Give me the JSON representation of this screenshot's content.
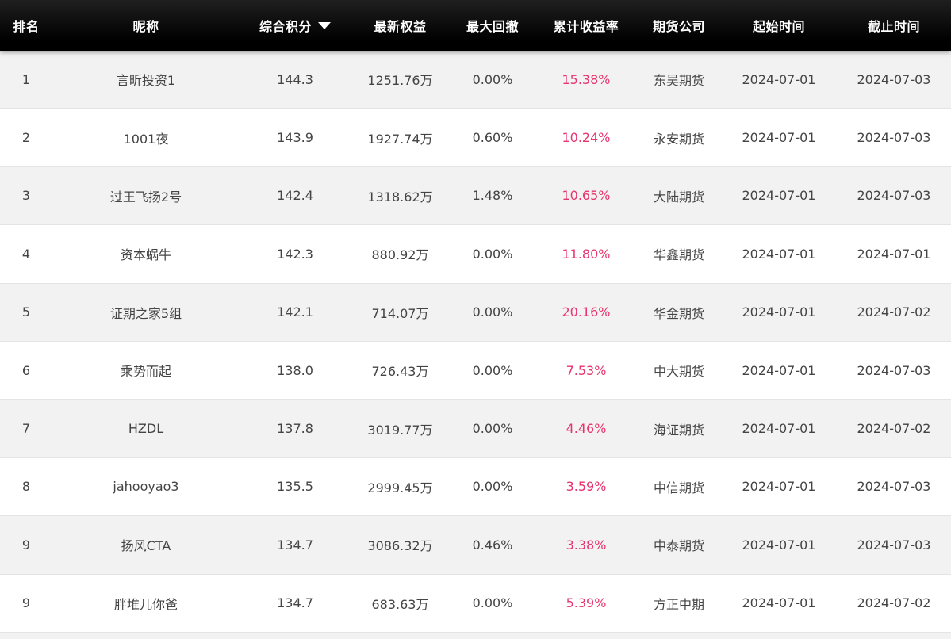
{
  "header": {
    "rank": "排名",
    "nickname": "昵称",
    "score": "综合积分",
    "equity": "最新权益",
    "max_drawdown": "最大回撤",
    "cum_return": "累计收益率",
    "broker": "期货公司",
    "start_date": "起始时间",
    "end_date": "截止时间"
  },
  "sort": {
    "column": "综合积分",
    "direction": "descending",
    "icon": "sort-down-triangle-icon"
  },
  "colors": {
    "header_bg": "#000000",
    "return_text": "#e8336d",
    "stripe_bg": "#f2f2f2"
  },
  "rows": [
    {
      "rank": "1",
      "nickname": "言昕投资1",
      "score": "144.3",
      "equity": "1251.76万",
      "max_drawdown": "0.00%",
      "cum_return": "15.38%",
      "broker": "东吴期货",
      "start_date": "2024-07-01",
      "end_date": "2024-07-03"
    },
    {
      "rank": "2",
      "nickname": "1001夜",
      "score": "143.9",
      "equity": "1927.74万",
      "max_drawdown": "0.60%",
      "cum_return": "10.24%",
      "broker": "永安期货",
      "start_date": "2024-07-01",
      "end_date": "2024-07-03"
    },
    {
      "rank": "3",
      "nickname": "过王飞扬2号",
      "score": "142.4",
      "equity": "1318.62万",
      "max_drawdown": "1.48%",
      "cum_return": "10.65%",
      "broker": "大陆期货",
      "start_date": "2024-07-01",
      "end_date": "2024-07-03"
    },
    {
      "rank": "4",
      "nickname": "资本蜗牛",
      "score": "142.3",
      "equity": "880.92万",
      "max_drawdown": "0.00%",
      "cum_return": "11.80%",
      "broker": "华鑫期货",
      "start_date": "2024-07-01",
      "end_date": "2024-07-01"
    },
    {
      "rank": "5",
      "nickname": "证期之家5组",
      "score": "142.1",
      "equity": "714.07万",
      "max_drawdown": "0.00%",
      "cum_return": "20.16%",
      "broker": "华金期货",
      "start_date": "2024-07-01",
      "end_date": "2024-07-02"
    },
    {
      "rank": "6",
      "nickname": "乘势而起",
      "score": "138.0",
      "equity": "726.43万",
      "max_drawdown": "0.00%",
      "cum_return": "7.53%",
      "broker": "中大期货",
      "start_date": "2024-07-01",
      "end_date": "2024-07-03"
    },
    {
      "rank": "7",
      "nickname": "HZDL",
      "score": "137.8",
      "equity": "3019.77万",
      "max_drawdown": "0.00%",
      "cum_return": "4.46%",
      "broker": "海证期货",
      "start_date": "2024-07-01",
      "end_date": "2024-07-02"
    },
    {
      "rank": "8",
      "nickname": "jahooyao3",
      "score": "135.5",
      "equity": "2999.45万",
      "max_drawdown": "0.00%",
      "cum_return": "3.59%",
      "broker": "中信期货",
      "start_date": "2024-07-01",
      "end_date": "2024-07-03"
    },
    {
      "rank": "9",
      "nickname": "扬风CTA",
      "score": "134.7",
      "equity": "3086.32万",
      "max_drawdown": "0.46%",
      "cum_return": "3.38%",
      "broker": "中泰期货",
      "start_date": "2024-07-01",
      "end_date": "2024-07-03"
    },
    {
      "rank": "9",
      "nickname": "胖堆儿你爸",
      "score": "134.7",
      "equity": "683.63万",
      "max_drawdown": "0.00%",
      "cum_return": "5.39%",
      "broker": "方正中期",
      "start_date": "2024-07-01",
      "end_date": "2024-07-02"
    }
  ]
}
